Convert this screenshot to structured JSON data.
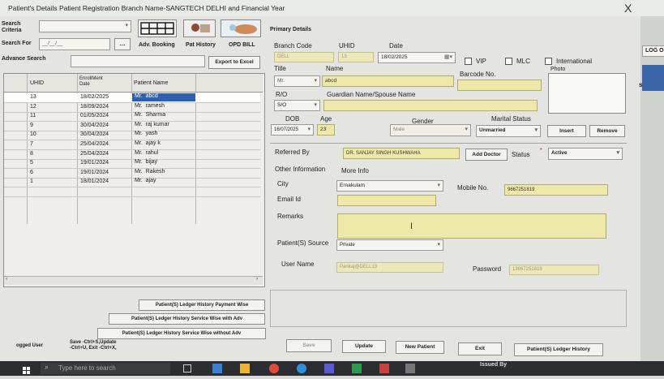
{
  "title_bar": {
    "title": "Patient's Details Patient Registration Branch Name-SANGTECH DELHI and Financial Year",
    "close_label": "X"
  },
  "left": {
    "search_criteria_label": "Search\nCriteria",
    "search_for_label": "Search For",
    "search_for_value": "__/__/__",
    "search_button_label": "....",
    "adv_booking_label": "Adv. Booking",
    "pat_history_label": "Pat History",
    "opd_bill_label": "OPD BILL",
    "advance_search_label": "Advance Search",
    "export_label": "Export to Excel",
    "table": {
      "headers": {
        "uhid": "UHID",
        "enroll": "EnrollMent\nDate",
        "name": "Patient Name"
      },
      "rows": [
        {
          "uhid": "13",
          "date": "18/02/2025",
          "title": "Mr.",
          "name": "abcd"
        },
        {
          "uhid": "12",
          "date": "18/09/2024",
          "title": "Mr.",
          "name": "ramesh"
        },
        {
          "uhid": "11",
          "date": "01/05/2024",
          "title": "Mr.",
          "name": "Sharma"
        },
        {
          "uhid": "9",
          "date": "30/04/2024",
          "title": "Mr.",
          "name": "raj kumar"
        },
        {
          "uhid": "10",
          "date": "30/04/2024",
          "title": "Mr.",
          "name": "yash"
        },
        {
          "uhid": "7",
          "date": "25/04/2024",
          "title": "Mr.",
          "name": "ajay k"
        },
        {
          "uhid": "8",
          "date": "25/04/2024",
          "title": "Mr.",
          "name": "rahul"
        },
        {
          "uhid": "5",
          "date": "19/01/2024",
          "title": "Mr.",
          "name": "bijay"
        },
        {
          "uhid": "6",
          "date": "19/01/2024",
          "title": "Mr.",
          "name": "Rakesh"
        },
        {
          "uhid": "1",
          "date": "18/01/2024",
          "title": "Mr.",
          "name": "ajay"
        }
      ]
    },
    "ledger_payment_label": "Patient(S) Ledger History Payment Wise",
    "ledger_service_adv_label": "Patient(S) Ledger History  Service Wise with Adv",
    "ledger_service_noadv_label": "Patient(S) Ledger History  Service Wise without  Adv",
    "logged_user_label": "ogged User",
    "shortcuts_label": "Save -Ctrl+S,Update\n-Ctrl+U, Exit -Ctrl+X,"
  },
  "right": {
    "primary_details_label": "Primary Details",
    "branch_code_label": "Branch Code",
    "branch_code_value": "DELL",
    "uhid_label": "UHID",
    "uhid_value": "13",
    "date_label": "Date",
    "date_value": "18/02/2025",
    "vip_label": "VIP",
    "mlc_label": "MLC",
    "international_label": "International",
    "photo_label": "Photo",
    "title_label": "Title",
    "title_value": "Mr.",
    "name_label": "Name",
    "name_value": "abcd",
    "barcode_label": "Barcode No.",
    "ro_label": "R/O",
    "ro_value": "S/O",
    "guardian_label": "Guardian Name/Spouse Name",
    "dob_label": "DOB",
    "dob_value": "16/07/2025",
    "age_label": "Age",
    "age_value": "23",
    "gender_label": "Gender",
    "gender_value": "Male",
    "marital_label": "Marital Status",
    "marital_value": "Unmarried",
    "insert_label": "Insert",
    "remove_label": "Remove",
    "referred_by_label": "Referred By",
    "referred_by_value": "DR. SANJAY SINGH KUSHWAHA",
    "add_doctor_label": "Add Doctor",
    "status_label": "Status",
    "status_value": "Active",
    "other_info_label": "Other Information",
    "more_info_label": "More Info",
    "city_label": "City",
    "city_value": "Ernakulam",
    "mobile_label": "Mobile No.",
    "mobile_value": "9667251819",
    "email_label": "Email Id",
    "remarks_label": "Remarks",
    "patient_source_label": "Patient(S) Source",
    "patient_source_value": "Private",
    "username_label": "User Name",
    "username_value": "Pankaj@DELL13",
    "password_label": "Password",
    "password_value": "13667251819",
    "save_label": "Save",
    "update_label": "Update",
    "new_patient_label": "New Patient",
    "exit_label": "Exit",
    "ledger_history_label": "Patient(S) Ledger History"
  },
  "side": {
    "log_label": "LOG O",
    "s_label": "s"
  },
  "taskbar": {
    "search_placeholder": "Type here to search",
    "issued_label": "Issued By"
  }
}
